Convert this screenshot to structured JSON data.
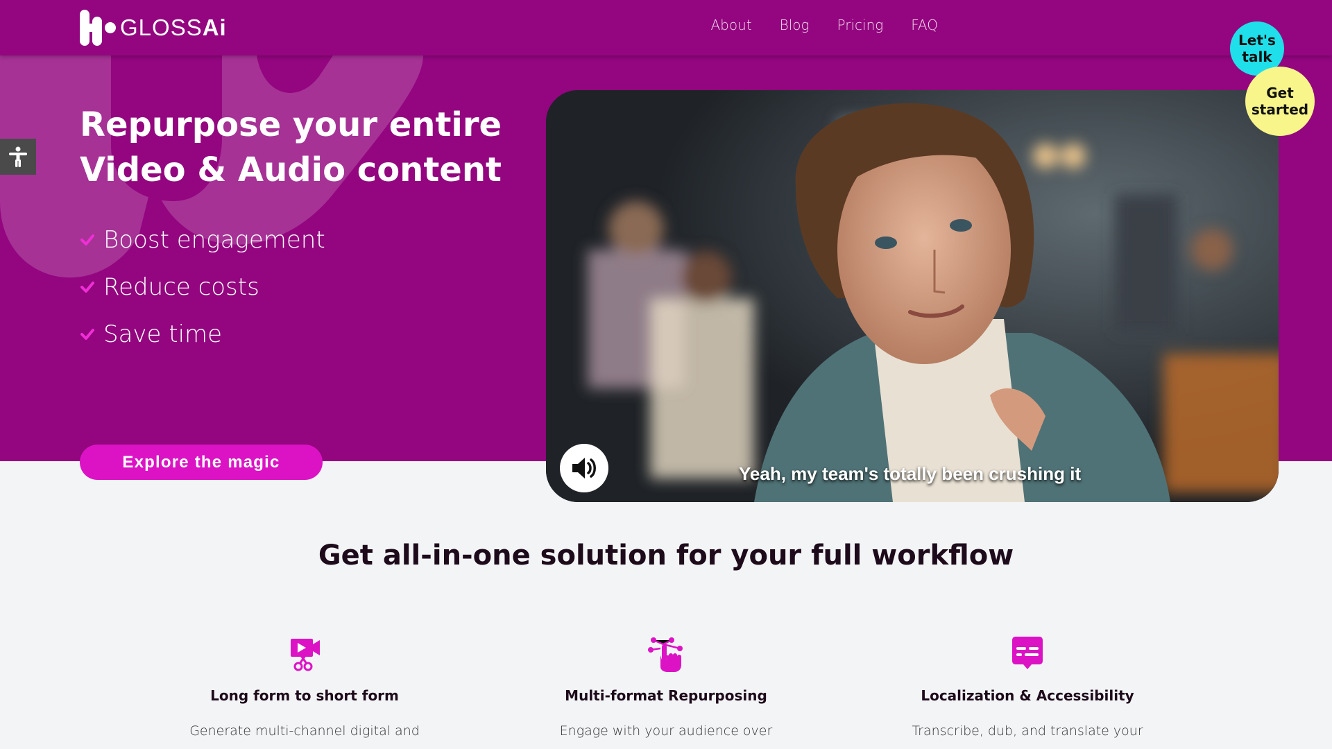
{
  "brand": {
    "name_light": "GLOSS",
    "name_bold": "Ai",
    "primary_color": "#93067f",
    "accent_color": "#dc13c5"
  },
  "nav": {
    "items": [
      "About",
      "Blog",
      "Pricing",
      "FAQ"
    ]
  },
  "hero": {
    "title_line1": "Repurpose your entire",
    "title_line2": "Video & Audio content",
    "features": [
      "Boost engagement",
      "Reduce costs",
      "Save time"
    ],
    "cta_label": "Explore the magic"
  },
  "video": {
    "caption": "Yeah, my team's totally been crushing it",
    "sound_icon": "speaker-icon"
  },
  "bubbles": {
    "talk_line1": "Let's",
    "talk_line2": "talk",
    "start_line1": "Get",
    "start_line2": "started",
    "talk_color": "#1fe0ea",
    "start_color": "#f8f58a"
  },
  "section": {
    "title": "Get all-in-one solution for your full workflow"
  },
  "cards": [
    {
      "icon": "video-scissors-icon",
      "title": "Long form to short form",
      "desc": "Generate multi-channel digital and"
    },
    {
      "icon": "hand-pointer-network-icon",
      "title": "Multi-format Repurposing",
      "desc": "Engage with your audience over"
    },
    {
      "icon": "subtitles-chat-icon",
      "title": "Localization & Accessibility",
      "desc": "Transcribe, dub, and translate your"
    }
  ],
  "accessibility": {
    "icon": "accessibility-person-icon"
  }
}
